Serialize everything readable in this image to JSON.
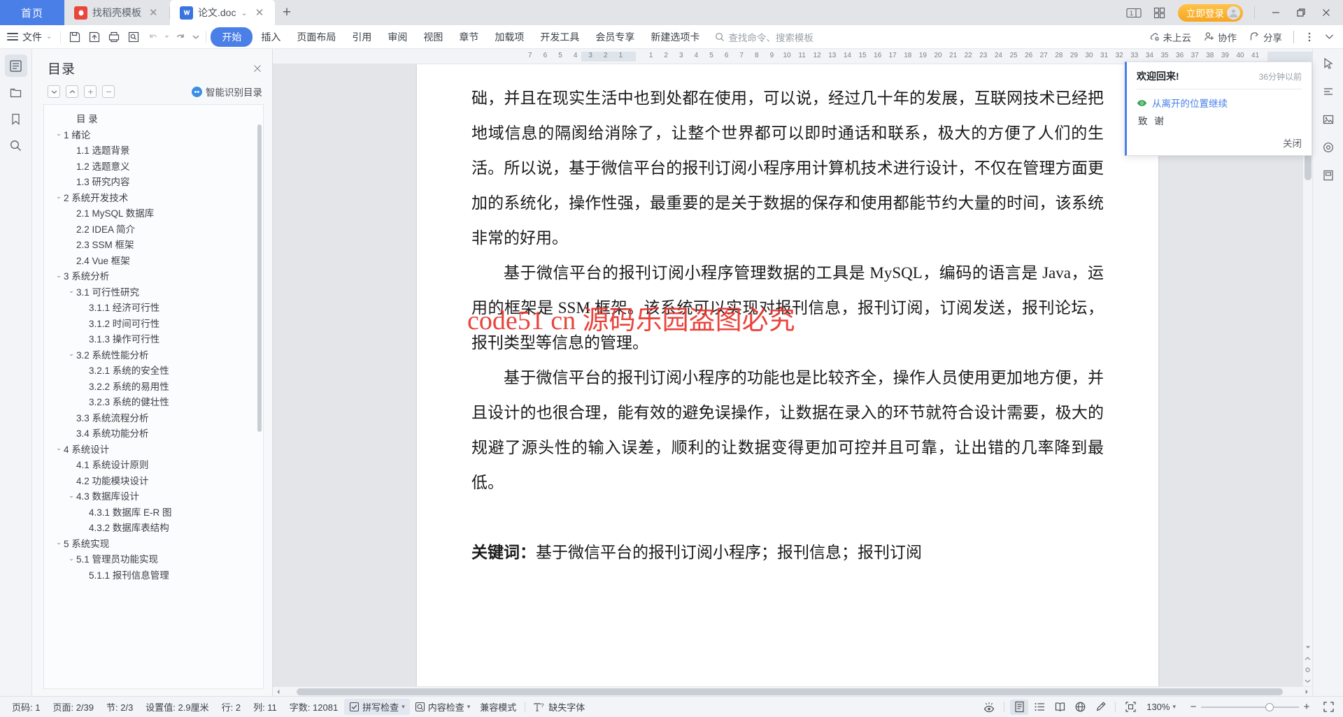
{
  "tabbar": {
    "home_label": "首页",
    "tabs": [
      {
        "label": "找稻壳模板",
        "icon": "daoke-icon",
        "active": false
      },
      {
        "label": "论文.doc",
        "icon": "wps-writer-icon",
        "active": true
      }
    ],
    "new_tab_label": "+",
    "login_label": "立即登录",
    "minimize_label": "—",
    "restore_label": "❐",
    "close_label": "✕"
  },
  "ribbon": {
    "file_label": "文件",
    "tabs": [
      "开始",
      "插入",
      "页面布局",
      "引用",
      "审阅",
      "视图",
      "章节",
      "加载项",
      "开发工具",
      "会员专享",
      "新建选项卡"
    ],
    "active_tab": "开始",
    "search_placeholder": "查找命令、搜索模板",
    "cloud_label": "未上云",
    "collab_label": "协作",
    "share_label": "分享"
  },
  "toc": {
    "title": "目录",
    "smart_label": "智能识别目录",
    "tools": [
      "expand-all",
      "collapse-all",
      "increase-level",
      "decrease-level"
    ],
    "items": [
      {
        "label": "目  录",
        "level": 1,
        "caret": ""
      },
      {
        "label": "1 绪论",
        "level": 1,
        "caret": "down"
      },
      {
        "label": "1.1 选题背景",
        "level": 2,
        "caret": ""
      },
      {
        "label": "1.2 选题意义",
        "level": 2,
        "caret": ""
      },
      {
        "label": "1.3 研究内容",
        "level": 2,
        "caret": ""
      },
      {
        "label": "2 系统开发技术",
        "level": 1,
        "caret": "down"
      },
      {
        "label": "2.1 MySQL 数据库",
        "level": 2,
        "caret": ""
      },
      {
        "label": "2.2 IDEA 简介",
        "level": 2,
        "caret": ""
      },
      {
        "label": "2.3 SSM 框架",
        "level": 2,
        "caret": ""
      },
      {
        "label": "2.4 Vue 框架",
        "level": 2,
        "caret": ""
      },
      {
        "label": "3 系统分析",
        "level": 1,
        "caret": "down"
      },
      {
        "label": "3.1 可行性研究",
        "level": 2,
        "caret": "down"
      },
      {
        "label": "3.1.1 经济可行性",
        "level": 3,
        "caret": ""
      },
      {
        "label": "3.1.2 时间可行性",
        "level": 3,
        "caret": ""
      },
      {
        "label": "3.1.3 操作可行性",
        "level": 3,
        "caret": ""
      },
      {
        "label": "3.2 系统性能分析",
        "level": 2,
        "caret": "down"
      },
      {
        "label": "3.2.1 系统的安全性",
        "level": 3,
        "caret": ""
      },
      {
        "label": "3.2.2 系统的易用性",
        "level": 3,
        "caret": ""
      },
      {
        "label": "3.2.3 系统的健壮性",
        "level": 3,
        "caret": ""
      },
      {
        "label": "3.3 系统流程分析",
        "level": 2,
        "caret": ""
      },
      {
        "label": "3.4 系统功能分析",
        "level": 2,
        "caret": ""
      },
      {
        "label": "4 系统设计",
        "level": 1,
        "caret": "down"
      },
      {
        "label": "4.1 系统设计原则",
        "level": 2,
        "caret": ""
      },
      {
        "label": "4.2 功能模块设计",
        "level": 2,
        "caret": ""
      },
      {
        "label": "4.3 数据库设计",
        "level": 2,
        "caret": "down"
      },
      {
        "label": "4.3.1 数据库 E-R 图",
        "level": 3,
        "caret": ""
      },
      {
        "label": "4.3.2 数据库表结构",
        "level": 3,
        "caret": ""
      },
      {
        "label": "5 系统实现",
        "level": 1,
        "caret": "down"
      },
      {
        "label": "5.1 管理员功能实现",
        "level": 2,
        "caret": "down"
      },
      {
        "label": "5.1.1 报刊信息管理",
        "level": 3,
        "caret": ""
      }
    ]
  },
  "ruler": {
    "left_marks": [
      "7",
      "6",
      "5",
      "4",
      "3",
      "2",
      "1"
    ],
    "right_marks": [
      "1",
      "2",
      "3",
      "4",
      "5",
      "6",
      "7",
      "8",
      "9",
      "10",
      "11",
      "12",
      "13",
      "14",
      "15",
      "16",
      "17",
      "18",
      "19",
      "20",
      "21",
      "22",
      "23",
      "24",
      "25",
      "26",
      "27",
      "28",
      "29",
      "30",
      "31",
      "32",
      "33",
      "34",
      "35",
      "36",
      "37",
      "38",
      "39",
      "40",
      "41"
    ]
  },
  "document": {
    "paragraphs": [
      {
        "text": "础，并且在现实生活中也到处都在使用，可以说，经过几十年的发展，互联网技术已经把地域信息的隔阂给消除了，让整个世界都可以即时通话和联系，极大的方便了人们的生活。所以说，基于微信平台的报刊订阅小程序用计算机技术进行设计，不仅在管理方面更加的系统化，操作性强，最重要的是关于数据的保存和使用都能节约大量的时间，该系统非常的好用。",
        "indent": false
      },
      {
        "text": "基于微信平台的报刊订阅小程序管理数据的工具是 MySQL，编码的语言是 Java，运用的框架是 SSM 框架。该系统可以实现对报刊信息，报刊订阅，订阅发送，报刊论坛，报刊类型等信息的管理。",
        "indent": true
      },
      {
        "text": "基于微信平台的报刊订阅小程序的功能也是比较齐全，操作人员使用更加地方便，并且设计的也很合理，能有效的避免误操作，让数据在录入的环节就符合设计需要，极大的规避了源头性的输入误差，顺利的让数据变得更加可控并且可靠，让出错的几率降到最低。",
        "indent": true
      }
    ],
    "keywords_label": "关键词：",
    "keywords_value": "基于微信平台的报刊订阅小程序；报刊信息；报刊订阅",
    "watermark": "code51 cn 源码乐园盗图必究"
  },
  "popup": {
    "title": "欢迎回来!",
    "time": "36分钟以前",
    "link": "从离开的位置继续",
    "subtitle": "致  谢",
    "close_label": "关闭"
  },
  "status": {
    "page_number": "页码: 1",
    "pages": "页面: 2/39",
    "section": "节: 2/3",
    "setting": "设置值: 2.9厘米",
    "row": "行: 2",
    "col": "列: 11",
    "words": "字数: 12081",
    "spellcheck": "拼写检查",
    "content_check": "内容检查",
    "compat_mode": "兼容模式",
    "missing_font": "缺失字体",
    "zoom": "130%"
  }
}
